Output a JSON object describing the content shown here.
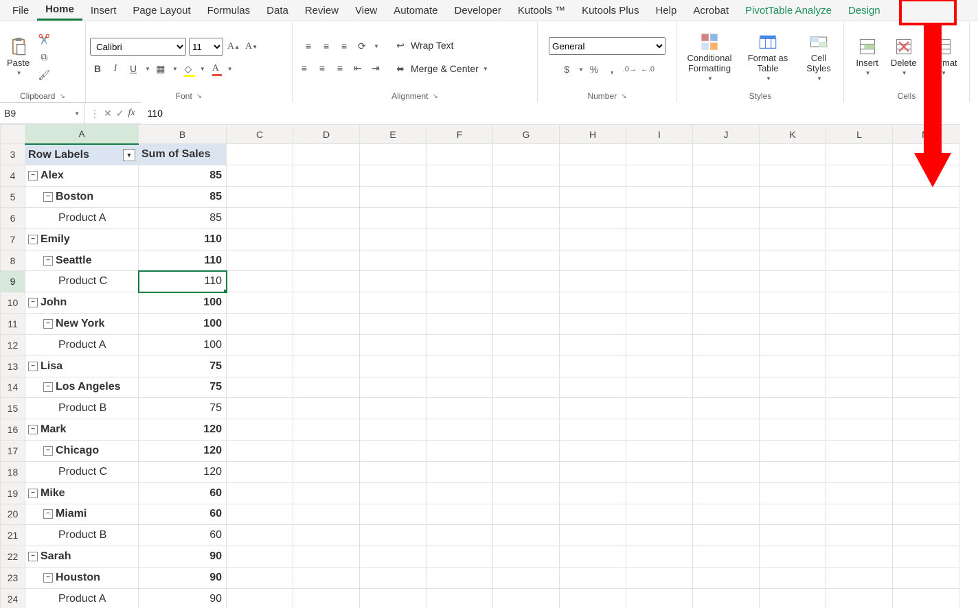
{
  "tabs": [
    "File",
    "Home",
    "Insert",
    "Page Layout",
    "Formulas",
    "Data",
    "Review",
    "View",
    "Automate",
    "Developer",
    "Kutools ™",
    "Kutools Plus",
    "Help",
    "Acrobat",
    "PivotTable Analyze",
    "Design"
  ],
  "activeTab": "Home",
  "highlightedTab": "Design",
  "ribbon": {
    "clipboard": {
      "paste": "Paste",
      "label": "Clipboard"
    },
    "font": {
      "name": "Calibri",
      "size": "11",
      "bold": "B",
      "italic": "I",
      "underline": "U",
      "label": "Font"
    },
    "alignment": {
      "wrap": "Wrap Text",
      "merge": "Merge & Center",
      "label": "Alignment"
    },
    "number": {
      "format": "General",
      "label": "Number"
    },
    "styles": {
      "cond": "Conditional Formatting",
      "fmtTable": "Format as Table",
      "cellStyles": "Cell Styles",
      "label": "Styles"
    },
    "cells": {
      "insert": "Insert",
      "delete": "Delete",
      "format": "Format",
      "label": "Cells"
    }
  },
  "formulaBar": {
    "nameBox": "B9",
    "formula": "110"
  },
  "columns": [
    "A",
    "B",
    "C",
    "D",
    "E",
    "F",
    "G",
    "H",
    "I",
    "J",
    "K",
    "L",
    "M"
  ],
  "colWidths": {
    "A": 165,
    "B": 128,
    "other": 97
  },
  "selection": {
    "row": 9,
    "col": "B"
  },
  "rows": [
    {
      "n": 3,
      "A": {
        "text": "Row Labels",
        "bold": true,
        "head": true
      },
      "B": {
        "text": "Sum of Sales",
        "bold": true,
        "head": true
      }
    },
    {
      "n": 4,
      "A": {
        "text": "Alex",
        "bold": true,
        "exp": true,
        "indent": 0
      },
      "B": {
        "text": "85",
        "bold": true
      }
    },
    {
      "n": 5,
      "A": {
        "text": "Boston",
        "bold": true,
        "exp": true,
        "indent": 1
      },
      "B": {
        "text": "85",
        "bold": true
      }
    },
    {
      "n": 6,
      "A": {
        "text": "Product A",
        "bold": false,
        "indent": 2
      },
      "B": {
        "text": "85",
        "bold": false
      }
    },
    {
      "n": 7,
      "A": {
        "text": "Emily",
        "bold": true,
        "exp": true,
        "indent": 0
      },
      "B": {
        "text": "110",
        "bold": true
      }
    },
    {
      "n": 8,
      "A": {
        "text": "Seattle",
        "bold": true,
        "exp": true,
        "indent": 1
      },
      "B": {
        "text": "110",
        "bold": true
      }
    },
    {
      "n": 9,
      "A": {
        "text": "Product C",
        "bold": false,
        "indent": 2
      },
      "B": {
        "text": "110",
        "bold": false
      }
    },
    {
      "n": 10,
      "A": {
        "text": "John",
        "bold": true,
        "exp": true,
        "indent": 0
      },
      "B": {
        "text": "100",
        "bold": true
      }
    },
    {
      "n": 11,
      "A": {
        "text": "New York",
        "bold": true,
        "exp": true,
        "indent": 1
      },
      "B": {
        "text": "100",
        "bold": true
      }
    },
    {
      "n": 12,
      "A": {
        "text": "Product A",
        "bold": false,
        "indent": 2
      },
      "B": {
        "text": "100",
        "bold": false
      }
    },
    {
      "n": 13,
      "A": {
        "text": "Lisa",
        "bold": true,
        "exp": true,
        "indent": 0
      },
      "B": {
        "text": "75",
        "bold": true
      }
    },
    {
      "n": 14,
      "A": {
        "text": "Los Angeles",
        "bold": true,
        "exp": true,
        "indent": 1
      },
      "B": {
        "text": "75",
        "bold": true
      }
    },
    {
      "n": 15,
      "A": {
        "text": "Product B",
        "bold": false,
        "indent": 2
      },
      "B": {
        "text": "75",
        "bold": false
      }
    },
    {
      "n": 16,
      "A": {
        "text": "Mark",
        "bold": true,
        "exp": true,
        "indent": 0
      },
      "B": {
        "text": "120",
        "bold": true
      }
    },
    {
      "n": 17,
      "A": {
        "text": "Chicago",
        "bold": true,
        "exp": true,
        "indent": 1
      },
      "B": {
        "text": "120",
        "bold": true
      }
    },
    {
      "n": 18,
      "A": {
        "text": "Product C",
        "bold": false,
        "indent": 2
      },
      "B": {
        "text": "120",
        "bold": false
      }
    },
    {
      "n": 19,
      "A": {
        "text": "Mike",
        "bold": true,
        "exp": true,
        "indent": 0
      },
      "B": {
        "text": "60",
        "bold": true
      }
    },
    {
      "n": 20,
      "A": {
        "text": "Miami",
        "bold": true,
        "exp": true,
        "indent": 1
      },
      "B": {
        "text": "60",
        "bold": true
      }
    },
    {
      "n": 21,
      "A": {
        "text": "Product B",
        "bold": false,
        "indent": 2
      },
      "B": {
        "text": "60",
        "bold": false
      }
    },
    {
      "n": 22,
      "A": {
        "text": "Sarah",
        "bold": true,
        "exp": true,
        "indent": 0
      },
      "B": {
        "text": "90",
        "bold": true
      }
    },
    {
      "n": 23,
      "A": {
        "text": "Houston",
        "bold": true,
        "exp": true,
        "indent": 1
      },
      "B": {
        "text": "90",
        "bold": true
      }
    },
    {
      "n": 24,
      "A": {
        "text": "Product A",
        "bold": false,
        "indent": 2
      },
      "B": {
        "text": "90",
        "bold": false
      }
    }
  ]
}
